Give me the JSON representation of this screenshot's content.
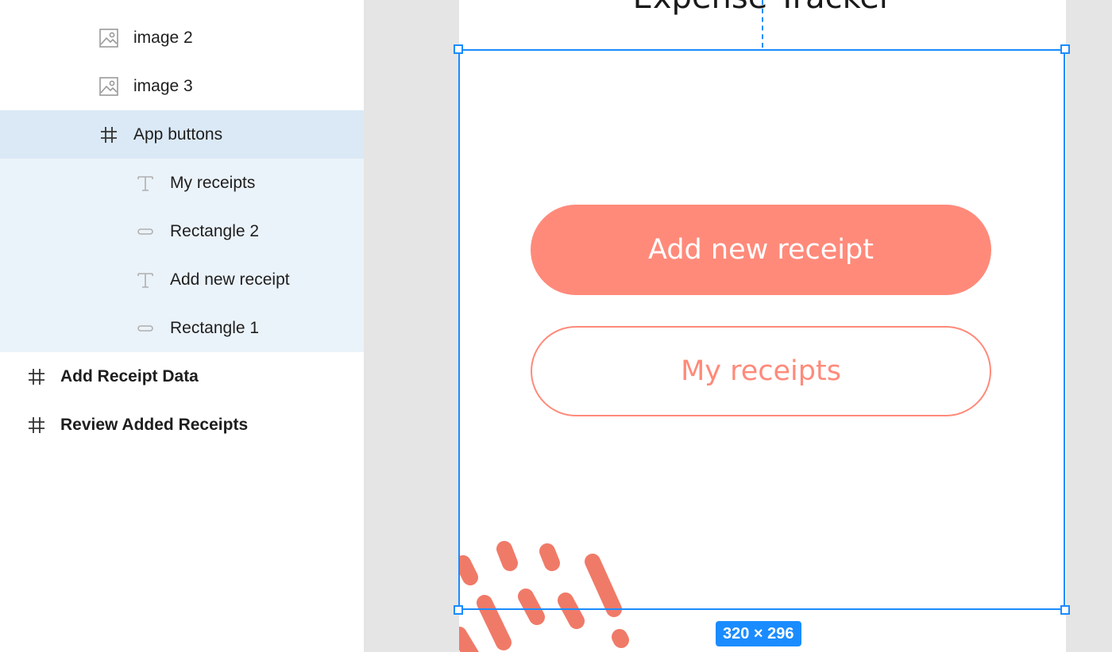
{
  "layers": {
    "items": [
      {
        "label": "image 2",
        "icon": "image-icon"
      },
      {
        "label": "image 3",
        "icon": "image-icon"
      },
      {
        "label": "App buttons",
        "icon": "frame-hash-icon",
        "state": "selected"
      },
      {
        "label": "My receipts",
        "icon": "text-icon"
      },
      {
        "label": "Rectangle 2",
        "icon": "rectangle-icon"
      },
      {
        "label": "Add new receipt",
        "icon": "text-icon"
      },
      {
        "label": "Rectangle 1",
        "icon": "rectangle-icon"
      },
      {
        "label": "Add Receipt Data",
        "icon": "frame-hash-icon"
      },
      {
        "label": "Review Added Receipts",
        "icon": "frame-hash-icon"
      }
    ]
  },
  "canvas": {
    "app_title": "Expense Tracker",
    "primary_button": "Add new receipt",
    "secondary_button": "My receipts",
    "selection_size": "320 × 296",
    "colors": {
      "accent": "#ff8a7a",
      "decor": "#f07a68",
      "selection": "#1a8cff"
    }
  }
}
